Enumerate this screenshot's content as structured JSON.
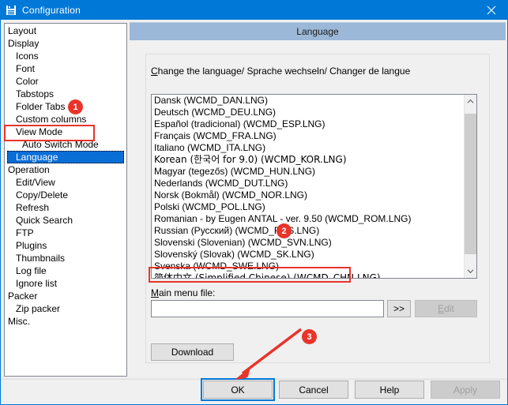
{
  "window": {
    "title": "Configuration",
    "icon": "save-floppy-icon",
    "close_label": "✕",
    "titlebar_color": "#0078d7"
  },
  "sidebar": {
    "items": [
      {
        "label": "Layout",
        "level": 0,
        "selected": false
      },
      {
        "label": "Display",
        "level": 0,
        "selected": false
      },
      {
        "label": "Icons",
        "level": 1,
        "selected": false
      },
      {
        "label": "Font",
        "level": 1,
        "selected": false
      },
      {
        "label": "Color",
        "level": 1,
        "selected": false
      },
      {
        "label": "Tabstops",
        "level": 1,
        "selected": false
      },
      {
        "label": "Folder Tabs",
        "level": 1,
        "selected": false
      },
      {
        "label": "Custom columns",
        "level": 1,
        "selected": false
      },
      {
        "label": "View Mode",
        "level": 1,
        "selected": false
      },
      {
        "label": "Auto Switch Mode",
        "level": 2,
        "selected": false
      },
      {
        "label": "Language",
        "level": 1,
        "selected": true
      },
      {
        "label": "Operation",
        "level": 0,
        "selected": false
      },
      {
        "label": "Edit/View",
        "level": 1,
        "selected": false
      },
      {
        "label": "Copy/Delete",
        "level": 1,
        "selected": false
      },
      {
        "label": "Refresh",
        "level": 1,
        "selected": false
      },
      {
        "label": "Quick Search",
        "level": 1,
        "selected": false
      },
      {
        "label": "FTP",
        "level": 1,
        "selected": false
      },
      {
        "label": "Plugins",
        "level": 1,
        "selected": false
      },
      {
        "label": "Thumbnails",
        "level": 1,
        "selected": false
      },
      {
        "label": "Log file",
        "level": 1,
        "selected": false
      },
      {
        "label": "Ignore list",
        "level": 1,
        "selected": false
      },
      {
        "label": "Packer",
        "level": 0,
        "selected": false
      },
      {
        "label": "Zip packer",
        "level": 1,
        "selected": false
      },
      {
        "label": "Misc.",
        "level": 0,
        "selected": false
      }
    ]
  },
  "page": {
    "header_title": "Language",
    "instruction_prefix": "C",
    "instruction_rest": "hange the language/ Sprache wechseln/ Changer de langue"
  },
  "language_list": {
    "items": [
      {
        "label": "Dansk (WCMD_DAN.LNG)",
        "selected": false,
        "cjk": false
      },
      {
        "label": "Deutsch (WCMD_DEU.LNG)",
        "selected": false,
        "cjk": false
      },
      {
        "label": "Español (tradicional) (WCMD_ESP.LNG)",
        "selected": false,
        "cjk": false
      },
      {
        "label": "Français (WCMD_FRA.LNG)",
        "selected": false,
        "cjk": false
      },
      {
        "label": "Italiano (WCMD_ITA.LNG)",
        "selected": false,
        "cjk": false
      },
      {
        "label": "Korean (한국어 for 9.0) (WCMD_KOR.LNG)",
        "selected": false,
        "cjk": true
      },
      {
        "label": "Magyar (tegezős) (WCMD_HUN.LNG)",
        "selected": false,
        "cjk": false
      },
      {
        "label": "Nederlands (WCMD_DUT.LNG)",
        "selected": false,
        "cjk": false
      },
      {
        "label": "Norsk (Bokmål) (WCMD_NOR.LNG)",
        "selected": false,
        "cjk": false
      },
      {
        "label": "Polski (WCMD_POL.LNG)",
        "selected": false,
        "cjk": false
      },
      {
        "label": "Romanian - by Eugen ANTAL - ver. 9.50 (WCMD_ROM.LNG)",
        "selected": false,
        "cjk": false
      },
      {
        "label": "Russian (Русский) (WCMD_RUS.LNG)",
        "selected": false,
        "cjk": false
      },
      {
        "label": "Slovenski (Slovenian) (WCMD_SVN.LNG)",
        "selected": false,
        "cjk": false
      },
      {
        "label": "Slovenský (Slovak) (WCMD_SK.LNG)",
        "selected": false,
        "cjk": false
      },
      {
        "label": "Svenska (WCMD_SWE.LNG)",
        "selected": false,
        "cjk": false
      },
      {
        "label": "简体中文 (Simplified Chinese) (WCMD_CHN.LNG)",
        "selected": false,
        "cjk": true
      }
    ],
    "scrollbar": {
      "up_arrow": "▲",
      "down_arrow": "▼"
    }
  },
  "main_menu": {
    "label_prefix": "M",
    "label_rest": "ain menu file:",
    "input_value": "",
    "input_placeholder": "",
    "browse_label": ">>",
    "edit_label_prefix": "E",
    "edit_label_rest": "dit",
    "edit_disabled": true,
    "download_label": "Download"
  },
  "dialog_buttons": {
    "ok": "OK",
    "cancel": "Cancel",
    "help": "Help",
    "apply": "Apply",
    "apply_disabled": true,
    "focused": "OK"
  },
  "annotations": {
    "color": "#e8342a",
    "badges": [
      {
        "number": "1",
        "target": "sidebar-item-language"
      },
      {
        "number": "2",
        "target": "language-list"
      },
      {
        "number": "3",
        "target": "ok-button"
      }
    ]
  }
}
